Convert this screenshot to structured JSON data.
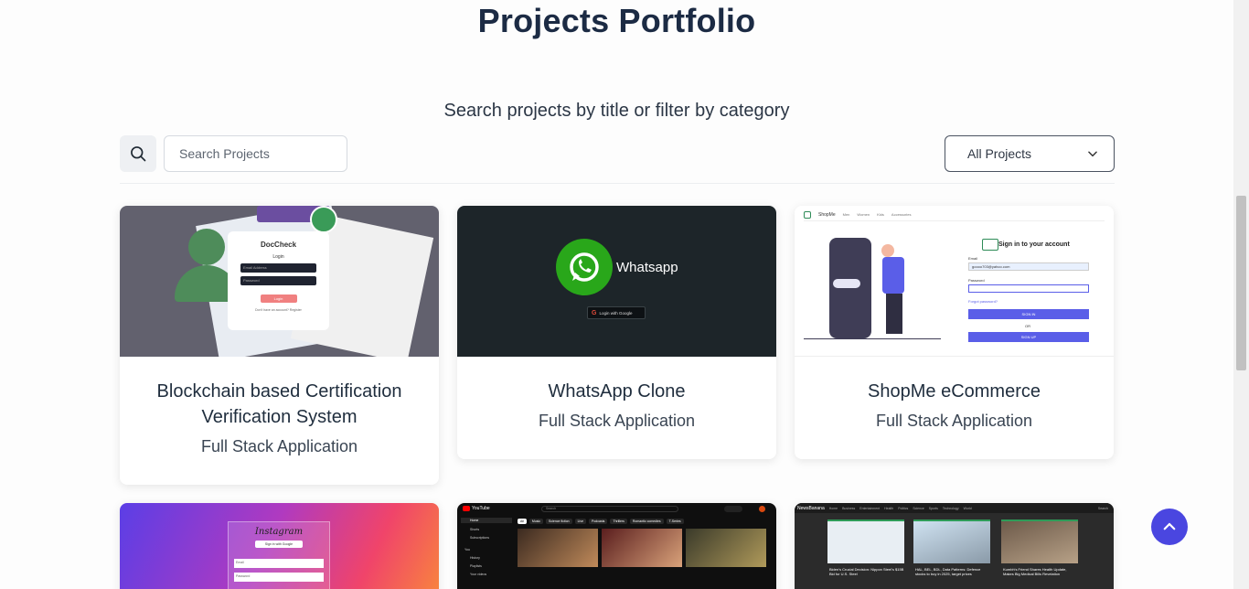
{
  "page": {
    "title": "Projects Portfolio",
    "subtitle": "Search projects by title or filter by category"
  },
  "search": {
    "placeholder": "Search Projects",
    "icon": "search-icon"
  },
  "filter": {
    "selected": "All Projects",
    "icon": "chevron-down-icon"
  },
  "projects": [
    {
      "title": "Blockchain based Certification Verification System",
      "category": "Full Stack Application",
      "thumb": {
        "app_name": "DocCheck",
        "form_title": "Login",
        "email_placeholder": "Email Address",
        "password_placeholder": "Password",
        "button": "Login",
        "footer": "Don't have an account? Register"
      }
    },
    {
      "title": "WhatsApp Clone",
      "category": "Full Stack Application",
      "thumb": {
        "app_name": "Whatsapp",
        "button": "Login with Google"
      }
    },
    {
      "title": "ShopMe eCommerce",
      "category": "Full Stack Application",
      "thumb": {
        "brand": "ShopMe",
        "nav": [
          "Men",
          "Women",
          "Kids",
          "Accessories"
        ],
        "heading": "Sign in to your account",
        "email_label": "Email",
        "email_value": "goooo703@yahoo.com",
        "password_label": "Password",
        "forgot": "Forgot password?",
        "sign_in": "SIGN IN",
        "or": "OR",
        "sign_up": "SIGN UP"
      }
    },
    {
      "thumb": {
        "app_name": "Instagram",
        "button": "Sign in with Google",
        "email": "Email",
        "password": "Password"
      }
    },
    {
      "thumb": {
        "app_name": "YouTube",
        "search": "Search",
        "chips": [
          "All",
          "Music",
          "Science fiction",
          "Live",
          "Podcasts",
          "Thrillers",
          "Romantic comedies",
          "T-Series",
          "Gaming",
          "Martial Arts Movies"
        ],
        "side": [
          "Home",
          "Shorts",
          "Subscriptions",
          "You",
          "History",
          "Playlists",
          "Your videos"
        ]
      }
    },
    {
      "thumb": {
        "app_name": "NewsBanana",
        "nav": [
          "Home",
          "Business",
          "Entertainment",
          "Health",
          "Politics",
          "Science",
          "Sports",
          "Technology",
          "World"
        ],
        "search": "Search",
        "headlines": [
          "Biden's Crucial Decision: Nippon Steel's $15B Bid for U.S. Steel",
          "HAL, BEL, BDL, Data Patterns: Defence stocks to buy in 2025, target prices",
          "Kumbh's Friend Shares Health Update, Makes Big Medical Bills Revelation"
        ]
      }
    }
  ],
  "colors": {
    "accent": "#4a46e0",
    "title": "#1c2b44"
  }
}
